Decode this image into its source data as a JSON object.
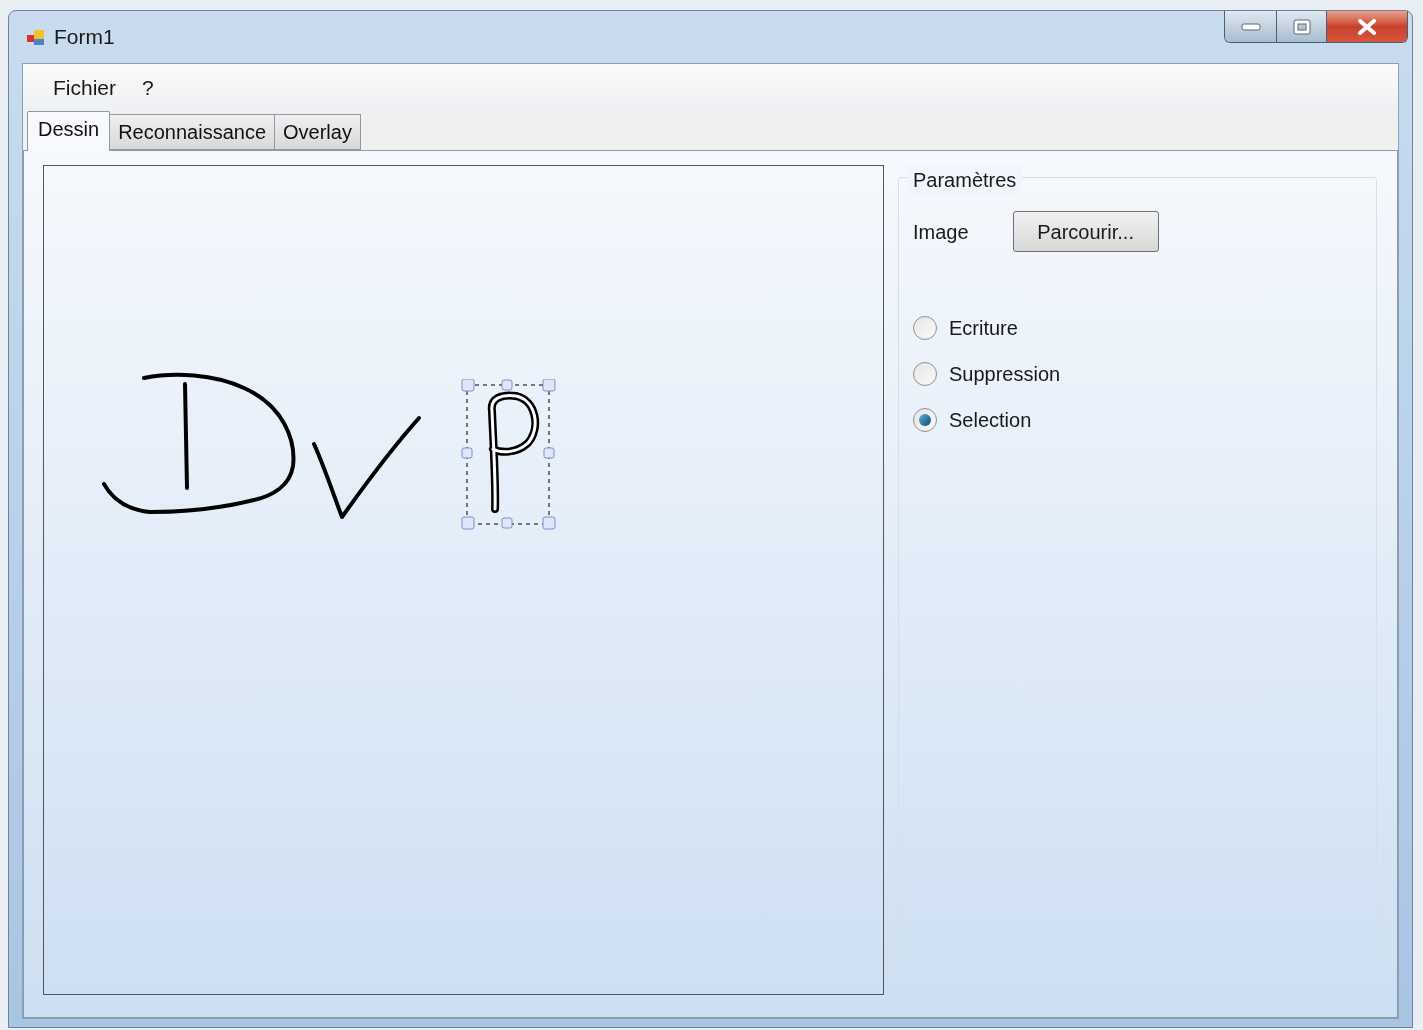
{
  "window": {
    "title": "Form1"
  },
  "menu": [
    {
      "label": "Fichier"
    },
    {
      "label": "?"
    }
  ],
  "tabs": [
    {
      "label": "Dessin",
      "selected": true
    },
    {
      "label": "Reconnaissance",
      "selected": false
    },
    {
      "label": "Overlay",
      "selected": false
    }
  ],
  "parameters": {
    "title": "Paramètres",
    "image_label": "Image",
    "browse_button": "Parcourir...",
    "modes": [
      {
        "label": "Ecriture",
        "selected": false
      },
      {
        "label": "Suppression",
        "selected": false
      },
      {
        "label": "Selection",
        "selected": true
      }
    ]
  }
}
